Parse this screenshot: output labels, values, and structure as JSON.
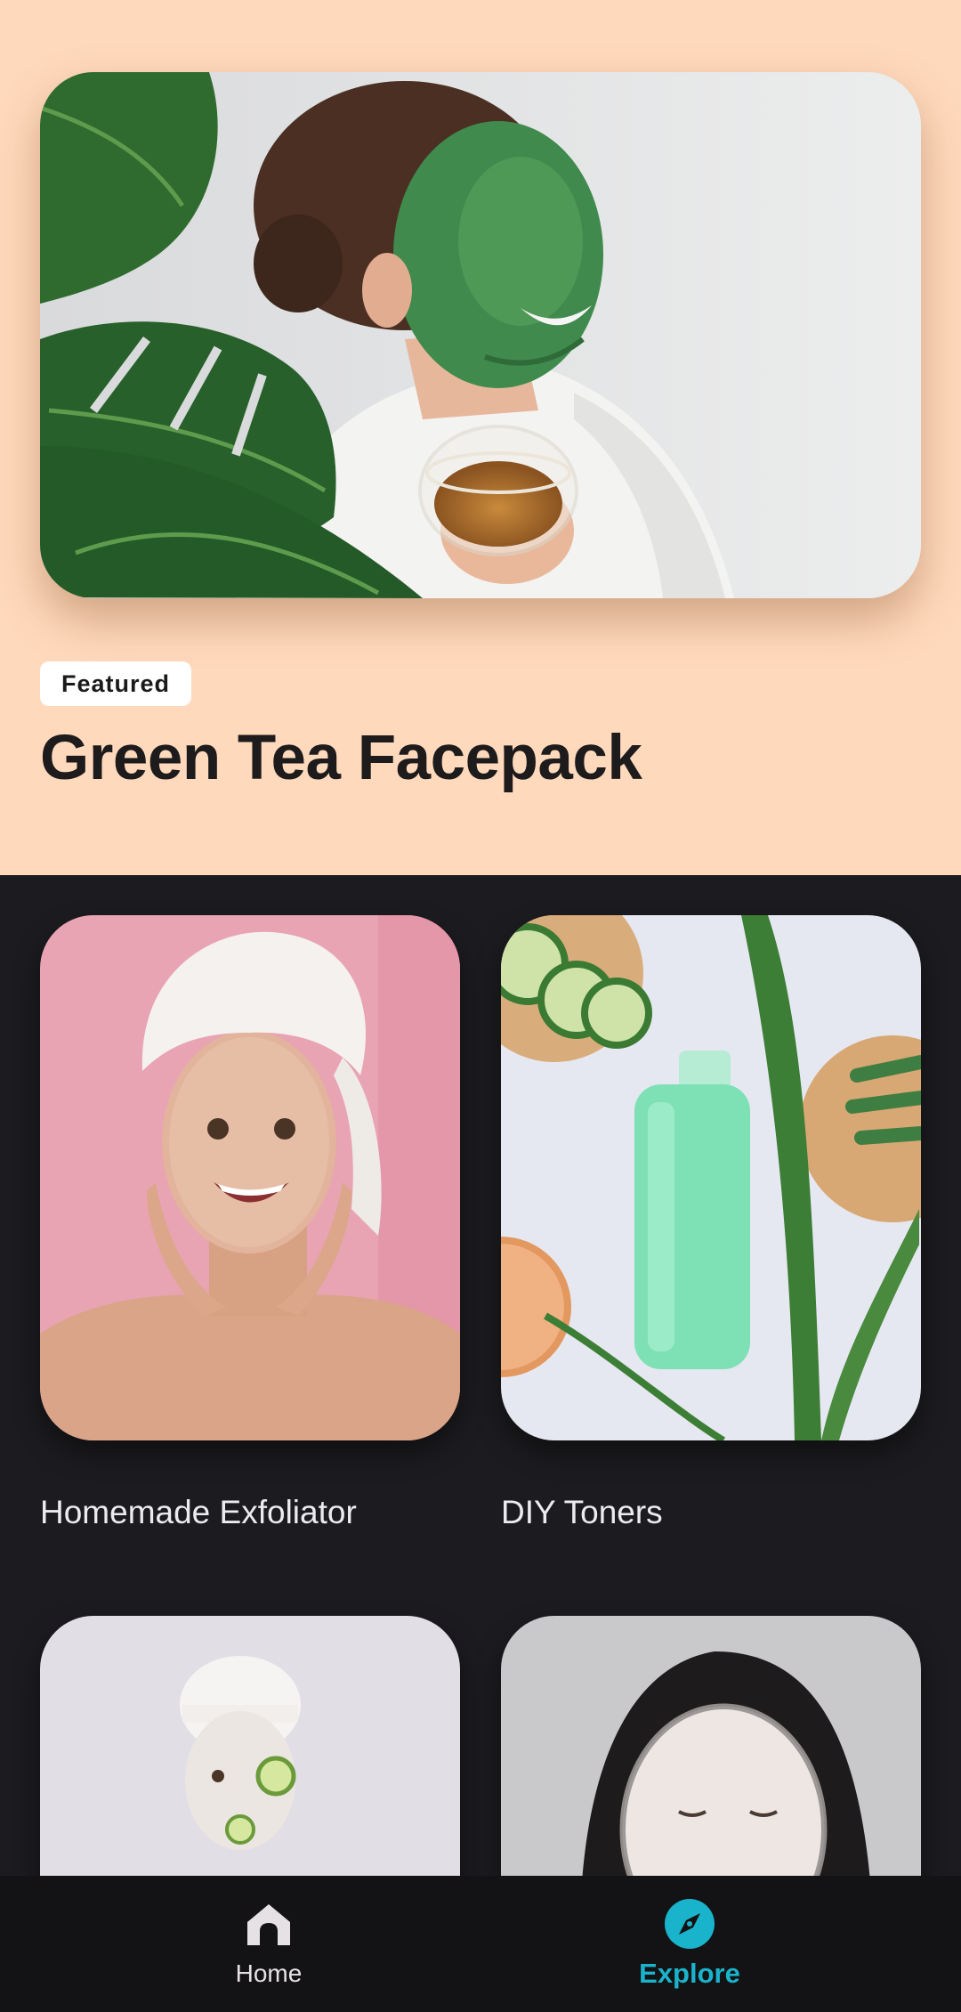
{
  "featured": {
    "badge": "Featured",
    "title": "Green Tea Facepack",
    "image": "woman-green-mask-tea-photo"
  },
  "grid": {
    "items": [
      {
        "label": "Homemade Exfoliator",
        "image": "woman-scrub-towel-photo"
      },
      {
        "label": "DIY Toners",
        "image": "green-bottle-cucumber-aloe-photo"
      },
      {
        "label": "",
        "image": "woman-cucumber-eye-mask-photo"
      },
      {
        "label": "",
        "image": "woman-sheet-mask-photo"
      }
    ]
  },
  "nav": {
    "items": [
      {
        "label": "Home",
        "icon": "home-icon",
        "selected": false
      },
      {
        "label": "Explore",
        "icon": "compass-icon",
        "selected": true
      }
    ]
  },
  "colors": {
    "featured_bg": "#ffd9bc",
    "page_bg": "#1c1b1f",
    "nav_bg": "#131315",
    "accent": "#1ab3cc"
  }
}
